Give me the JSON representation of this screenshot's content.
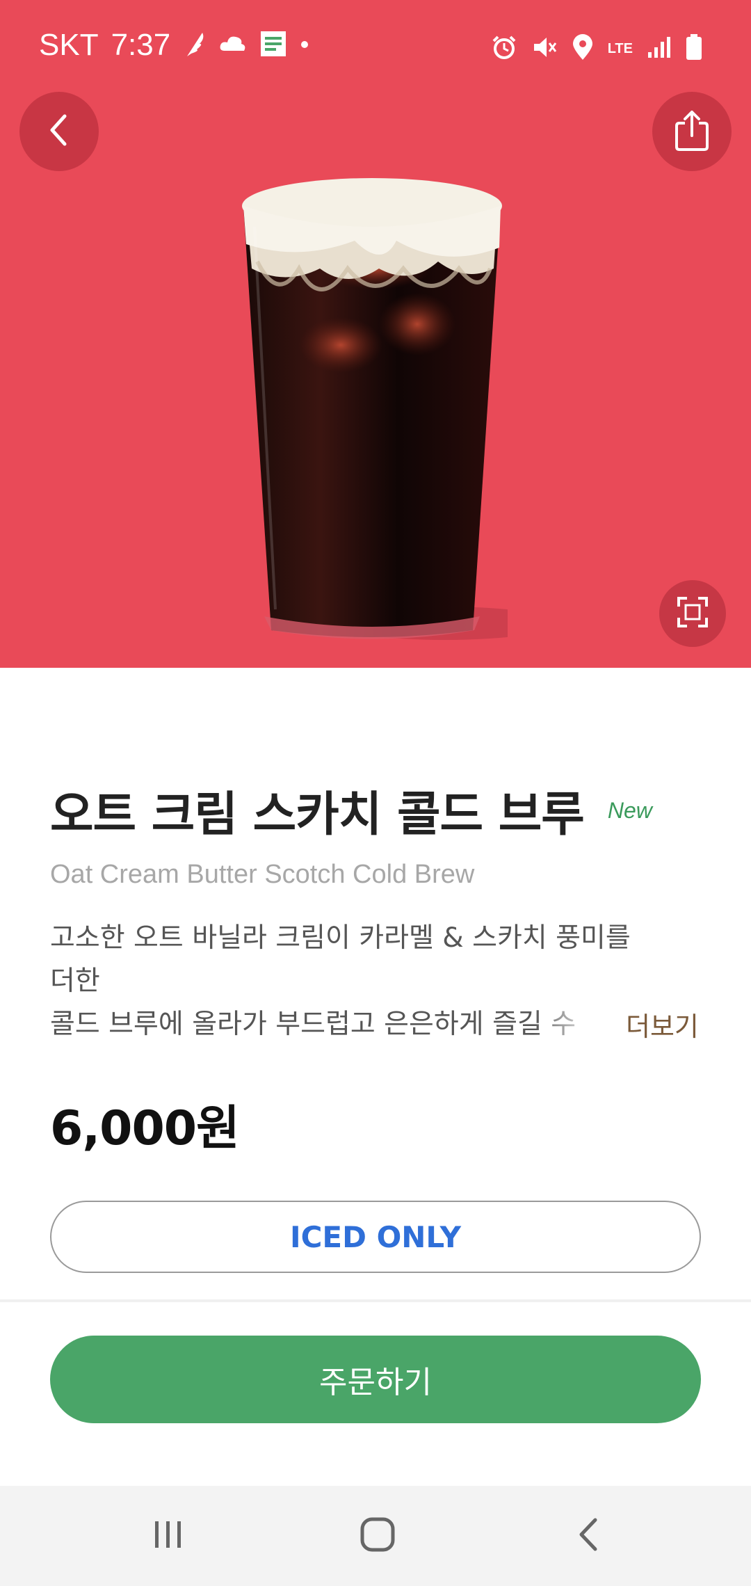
{
  "status_bar": {
    "carrier": "SKT",
    "time": "7:37",
    "network": "LTE"
  },
  "product": {
    "name_ko": "오트 크림 스카치 콜드 브루",
    "badge": "New",
    "name_en": "Oat Cream Butter Scotch Cold Brew",
    "description_lines": [
      "고소한 오트 바닐라 크림이 카라멜 & 스카치 풍미를",
      "더한",
      "콜드 브루에 올라가 부드럽고 은은하게 즐길 수"
    ],
    "more_label": "더보기",
    "price": "6,000원",
    "temperature_option": "ICED ONLY"
  },
  "actions": {
    "order_label": "주문하기"
  },
  "colors": {
    "hero_background": "#e94a58",
    "accent_green": "#4aa568",
    "new_badge": "#3a9a5b",
    "iced_text": "#2f6fd8",
    "more_link": "#7b5a3a"
  },
  "icons": {
    "back": "chevron-left-icon",
    "share": "share-icon",
    "expand": "fullscreen-icon",
    "nav_recent": "recent-apps-icon",
    "nav_home": "home-icon",
    "nav_back": "back-icon"
  }
}
